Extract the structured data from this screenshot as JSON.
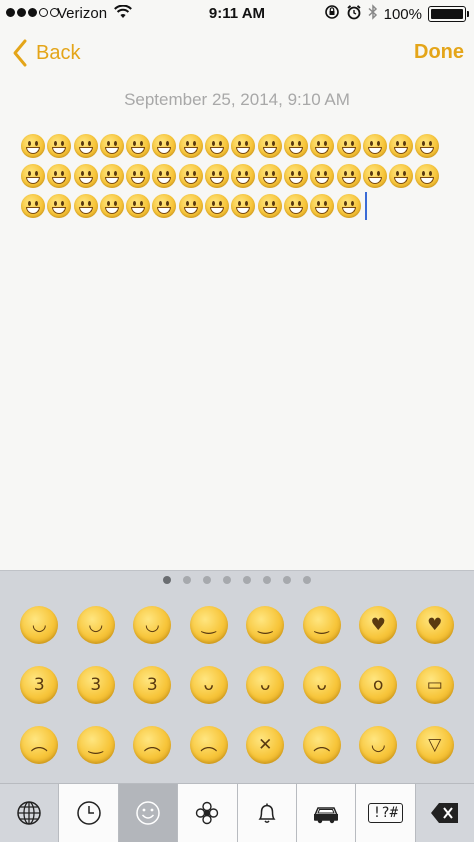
{
  "status_bar": {
    "carrier": "Verizon",
    "time": "9:11 AM",
    "battery": "100%"
  },
  "nav": {
    "back_label": "Back",
    "done_label": "Done"
  },
  "note": {
    "date": "September 25, 2014, 9:10 AM",
    "rows": [
      16,
      16,
      13
    ]
  },
  "keyboard": {
    "page_count": 8,
    "active_page": 0,
    "emoji_rows": [
      [
        "grinning-face",
        "smiley-face",
        "grin-face",
        "blush-face",
        "relaxed-face",
        "wink-face",
        "heart-eyes-face",
        "kissing-heart-face"
      ],
      [
        "kissing-closed-eyes-face",
        "kissing-face",
        "kissing-smiling-eyes-face",
        "tongue-wink-face",
        "tongue-closed-eyes-face",
        "tongue-face",
        "flushed-face",
        "grimacing-face"
      ],
      [
        "pensive-face",
        "relieved-face",
        "unamused-face",
        "disappointed-face",
        "persevere-face",
        "cry-face",
        "joy-face",
        "sob-face"
      ]
    ],
    "bottom_keys": [
      "globe-icon",
      "clock-icon",
      "smiley-icon",
      "flower-icon",
      "bell-icon",
      "car-icon",
      "symbols-icon",
      "delete-icon"
    ],
    "symbols_label": "!?#"
  },
  "colors": {
    "accent": "#e4a519",
    "caret": "#3a6bd6"
  }
}
